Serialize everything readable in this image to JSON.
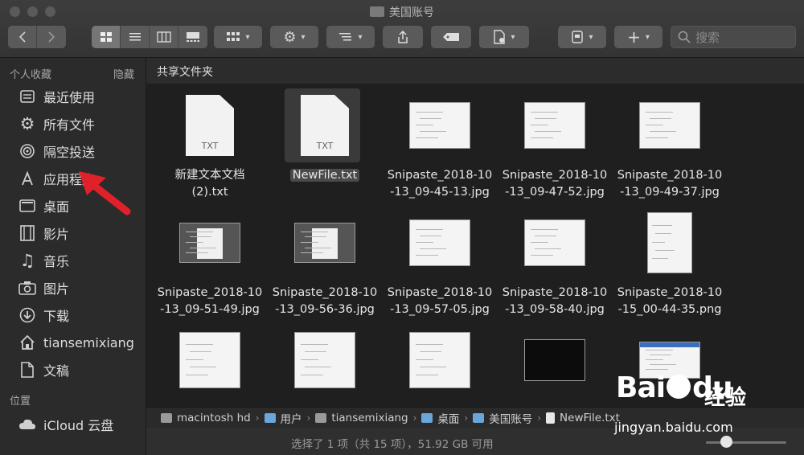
{
  "window": {
    "title": "美国账号"
  },
  "search": {
    "placeholder": "搜索"
  },
  "sidebar": {
    "favorites_label": "个人收藏",
    "hide_label": "隐藏",
    "items": [
      {
        "label": "最近使用",
        "icon": "recents-icon"
      },
      {
        "label": "所有文件",
        "icon": "all-files-icon"
      },
      {
        "label": "隔空投送",
        "icon": "airdrop-icon"
      },
      {
        "label": "应用程序",
        "icon": "applications-icon"
      },
      {
        "label": "桌面",
        "icon": "desktop-icon"
      },
      {
        "label": "影片",
        "icon": "movies-icon"
      },
      {
        "label": "音乐",
        "icon": "music-icon"
      },
      {
        "label": "图片",
        "icon": "pictures-icon"
      },
      {
        "label": "下载",
        "icon": "downloads-icon"
      },
      {
        "label": "tiansemixiang",
        "icon": "home-icon"
      },
      {
        "label": "文稿",
        "icon": "documents-icon"
      }
    ],
    "locations_label": "位置",
    "locations": [
      {
        "label": "iCloud 云盘",
        "icon": "icloud-icon"
      }
    ]
  },
  "main": {
    "header": "共享文件夹",
    "files": [
      {
        "name": "新建文本文档\n(2).txt",
        "kind": "txt",
        "badge": "TXT"
      },
      {
        "name": "NewFile.txt",
        "kind": "txt",
        "badge": "TXT",
        "selected": true
      },
      {
        "name": "Snipaste_2018-10\n-13_09-45-13.jpg",
        "kind": "img"
      },
      {
        "name": "Snipaste_2018-10\n-13_09-47-52.jpg",
        "kind": "img"
      },
      {
        "name": "Snipaste_2018-10\n-13_09-49-37.jpg",
        "kind": "img"
      },
      {
        "name": "Snipaste_2018-10\n-13_09-51-49.jpg",
        "kind": "img-dark"
      },
      {
        "name": "Snipaste_2018-10\n-13_09-56-36.jpg",
        "kind": "img-dark"
      },
      {
        "name": "Snipaste_2018-10\n-13_09-57-05.jpg",
        "kind": "img"
      },
      {
        "name": "Snipaste_2018-10\n-13_09-58-40.jpg",
        "kind": "img"
      },
      {
        "name": "Snipaste_2018-10\n-15_00-44-35.png",
        "kind": "img-tall"
      },
      {
        "name": "",
        "kind": "img"
      },
      {
        "name": "",
        "kind": "img"
      },
      {
        "name": "",
        "kind": "img"
      },
      {
        "name": "",
        "kind": "img-black"
      },
      {
        "name": "",
        "kind": "img-blue"
      }
    ]
  },
  "pathbar": {
    "crumbs": [
      {
        "label": "macintosh hd",
        "icon": "disk-icon"
      },
      {
        "label": "用户",
        "icon": "folder-icon"
      },
      {
        "label": "tiansemixiang",
        "icon": "home-icon"
      },
      {
        "label": "桌面",
        "icon": "folder-icon"
      },
      {
        "label": "美国账号",
        "icon": "folder-icon"
      },
      {
        "label": "NewFile.txt",
        "icon": "file-icon"
      }
    ]
  },
  "status": {
    "text": "选择了 1 项（共 15 项），51.92 GB 可用",
    "icon_size_fraction": 0.25
  },
  "watermark": {
    "brand": "Bai",
    "brand_suffix": "du",
    "product": "经验",
    "url": "jingyan.baidu.com"
  },
  "colors": {
    "accent_red": "#e0202a",
    "folder_blue": "#6aa7d8",
    "toolbar_bg": "#3a3a3a",
    "sidebar_bg": "#2b2b2b"
  }
}
